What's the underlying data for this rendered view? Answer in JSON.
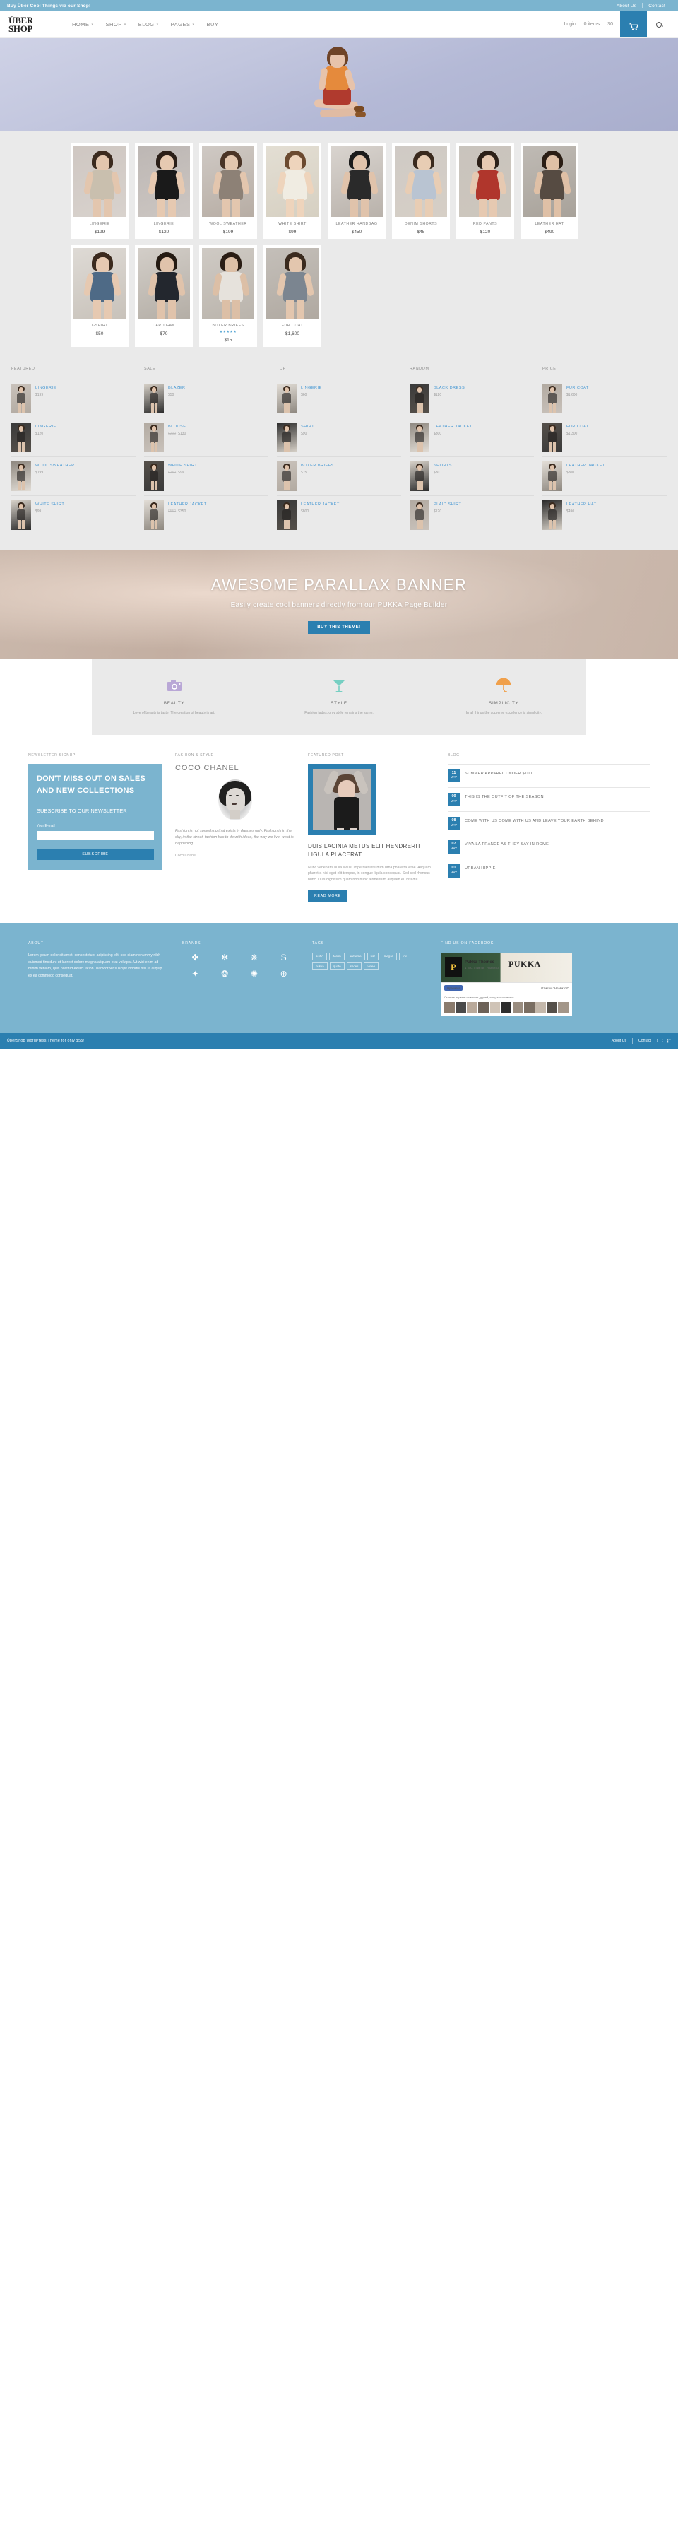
{
  "topbar": {
    "tagline": "Buy Über Cool Things via our Shop!",
    "links": [
      "About Us",
      "Contact"
    ]
  },
  "header": {
    "logo_line1": "ÜBER",
    "logo_line2": "SHOP",
    "nav": [
      {
        "label": "HOME",
        "caret": true
      },
      {
        "label": "SHOP",
        "caret": true
      },
      {
        "label": "BLOG",
        "caret": true
      },
      {
        "label": "PAGES",
        "caret": true
      },
      {
        "label": "BUY",
        "caret": false
      }
    ],
    "login_label": "Login",
    "cart_items": "0 items",
    "cart_total": "$0",
    "cart_icon": "cart-icon",
    "search_icon": "search-icon"
  },
  "products": [
    {
      "name": "LINGERIE",
      "price": "$199"
    },
    {
      "name": "LINGERIE",
      "price": "$120"
    },
    {
      "name": "WOOL SWEATHER",
      "price": "$199"
    },
    {
      "name": "WHITE SHIRT",
      "price": "$99"
    },
    {
      "name": "LEATHER HANDBAG",
      "price": "$450"
    },
    {
      "name": "DENIM SHORTS",
      "price": "$45"
    },
    {
      "name": "RED PANTS",
      "price": "$120"
    },
    {
      "name": "LEATHER HAT",
      "price": "$490"
    },
    {
      "name": "T-SHIRT",
      "price": "$50"
    },
    {
      "name": "CARDIGAN",
      "price": "$70"
    },
    {
      "name": "BOXER BRIEFS",
      "price": "$15",
      "stars": "★★★★★"
    },
    {
      "name": "FUR COAT",
      "price": "$1,600"
    }
  ],
  "lists": [
    {
      "head": "FEATURED",
      "items": [
        {
          "name": "LINGERIE",
          "price": "$199"
        },
        {
          "name": "LINGERIE",
          "price": "$120"
        },
        {
          "name": "WOOL SWEATHER",
          "price": "$199"
        },
        {
          "name": "WHITE SHIRT",
          "price": "$99"
        }
      ]
    },
    {
      "head": "SALE",
      "items": [
        {
          "name": "BLAZER",
          "price": "$50"
        },
        {
          "name": "BLOUSE",
          "old": "$200",
          "price": "$130"
        },
        {
          "name": "WHITE SHIRT",
          "old": "$150",
          "price": "$99"
        },
        {
          "name": "LEATHER JACKET",
          "old": "$550",
          "price": "$350"
        }
      ]
    },
    {
      "head": "TOP",
      "items": [
        {
          "name": "LINGERIE",
          "price": "$60"
        },
        {
          "name": "SHIRT",
          "price": "$90"
        },
        {
          "name": "BOXER BRIEFS",
          "price": "$15"
        },
        {
          "name": "LEATHER JACKET",
          "price": "$800"
        }
      ]
    },
    {
      "head": "RANDOM",
      "items": [
        {
          "name": "BLACK DRESS",
          "price": "$120"
        },
        {
          "name": "LEATHER JACKET",
          "price": "$800"
        },
        {
          "name": "SHORTS",
          "price": "$80"
        },
        {
          "name": "PLAID SHIRT",
          "price": "$120"
        }
      ]
    },
    {
      "head": "PRICE",
      "items": [
        {
          "name": "FUR COAT",
          "price": "$1,600"
        },
        {
          "name": "FUR COAT",
          "price": "$1,300"
        },
        {
          "name": "LEATHER JACKET",
          "price": "$800"
        },
        {
          "name": "LEATHER HAT",
          "price": "$490"
        }
      ]
    }
  ],
  "parallax": {
    "title": "AWESOME PARALLAX BANNER",
    "subtitle": "Easily create cool banners directly from our PUKKA Page Builder",
    "button": "BUY THIS THEME!"
  },
  "features": [
    {
      "icon": "camera-icon",
      "title": "BEAUTY",
      "desc": "Love of beauty is taste. The creation of beauty is art."
    },
    {
      "icon": "cocktail-icon",
      "title": "STYLE",
      "desc": "Fashion fades, only style remains the same."
    },
    {
      "icon": "umbrella-icon",
      "title": "SIMPLICITY",
      "desc": "In all things the supreme excellence is simplicity."
    }
  ],
  "newsletter": {
    "head": "NEWSLETTER SIGNUP",
    "headline": "DON'T MISS OUT ON SALES AND NEW COLLECTIONS",
    "paragraph": "SUBSCRIBE TO OUR NEWSLETTER",
    "field_label": "Your E-mail",
    "field_value": "",
    "field_placeholder": "",
    "button": "SUBSCRIBE"
  },
  "quote": {
    "head": "FASHION & STYLE",
    "name": "COCO CHANEL",
    "text": "Fashion is not something that exists in dresses only. Fashion is in the sky, in the street, fashion has to do with ideas, the way we live, what is happening.",
    "attribution": "Coco Chanel"
  },
  "featured_post": {
    "head": "FEATURED POST",
    "title": "DUIS LACINIA METUS ELIT HENDRERIT LIGULA PLACERAT",
    "body": "Nunc venenatis nulla lacus, imperdiet interdum urna pharetra vitae. Aliquam pharetra nisi eget elit tempus, in congue ligula consequat. Sed sed rhoncus nunc. Duis dignissim quam non nunc fermentum aliquam eu nisi dui.",
    "button": "READ MORE"
  },
  "blog": {
    "head": "BLOG",
    "posts": [
      {
        "day": "11",
        "month": "MAY",
        "title": "SUMMER APPAREL UNDER $100"
      },
      {
        "day": "09",
        "month": "MAY",
        "title": "THIS IS THE OUTFIT OF THE SEASON"
      },
      {
        "day": "08",
        "month": "MAY",
        "title": "COME WITH US COME WITH US AND LEAVE YOUR EARTH BEHIND"
      },
      {
        "day": "07",
        "month": "MAY",
        "title": "VIVA LA FRANCE AS THEY SAY IN ROME"
      },
      {
        "day": "01",
        "month": "MAY",
        "title": "URBAN HIPPIE"
      }
    ]
  },
  "footer": {
    "about_head": "ABOUT",
    "about_text": "Lorem ipsum dolor sit amet, consectetuer adipiscing elit, sed diam nonummy nibh euismod tincidunt ut laoreet dolore magna aliquam erat volutpat. Ut wisi enim ad minim veniam, quis nostrud exerci tation ullamcorper suscipit lobortis nisl ut aliquip ex ea commodo consequat.",
    "brands_head": "BRANDS",
    "brands": [
      "brand-mark-1",
      "brand-mark-2",
      "brand-mark-3",
      "brand-mark-4",
      "brand-mark-5",
      "brand-mark-6",
      "brand-mark-7",
      "brand-mark-8"
    ],
    "tags_head": "TAGS",
    "tags": [
      "audio",
      "denim",
      "extreme",
      "hat",
      "megan",
      "fox",
      "pukka",
      "quote",
      "shoes",
      "video"
    ],
    "facebook_head": "FIND US ON FACEBOOK",
    "fb_page_name": "Pukka Themes",
    "fb_page_sub": "1 тыс. отметок \"Нравится\"",
    "fb_brand": "PUKKA",
    "fb_like": "Нравится",
    "fb_like_count": "Отметки \"Нравится\"",
    "fb_caption": "Станьте первым из ваших друзей, кому это нравится."
  },
  "bottombar": {
    "credit": "ÜberShop WordPress Theme for only $55!",
    "links": [
      "About Us",
      "Contact"
    ],
    "social": [
      "f",
      "t",
      "g+"
    ]
  },
  "colors": {
    "light_blue": "#7bb4cf",
    "dark_blue": "#2b7fb0",
    "grey_bg": "#eaeaea",
    "link_blue": "#4a9ad4"
  }
}
